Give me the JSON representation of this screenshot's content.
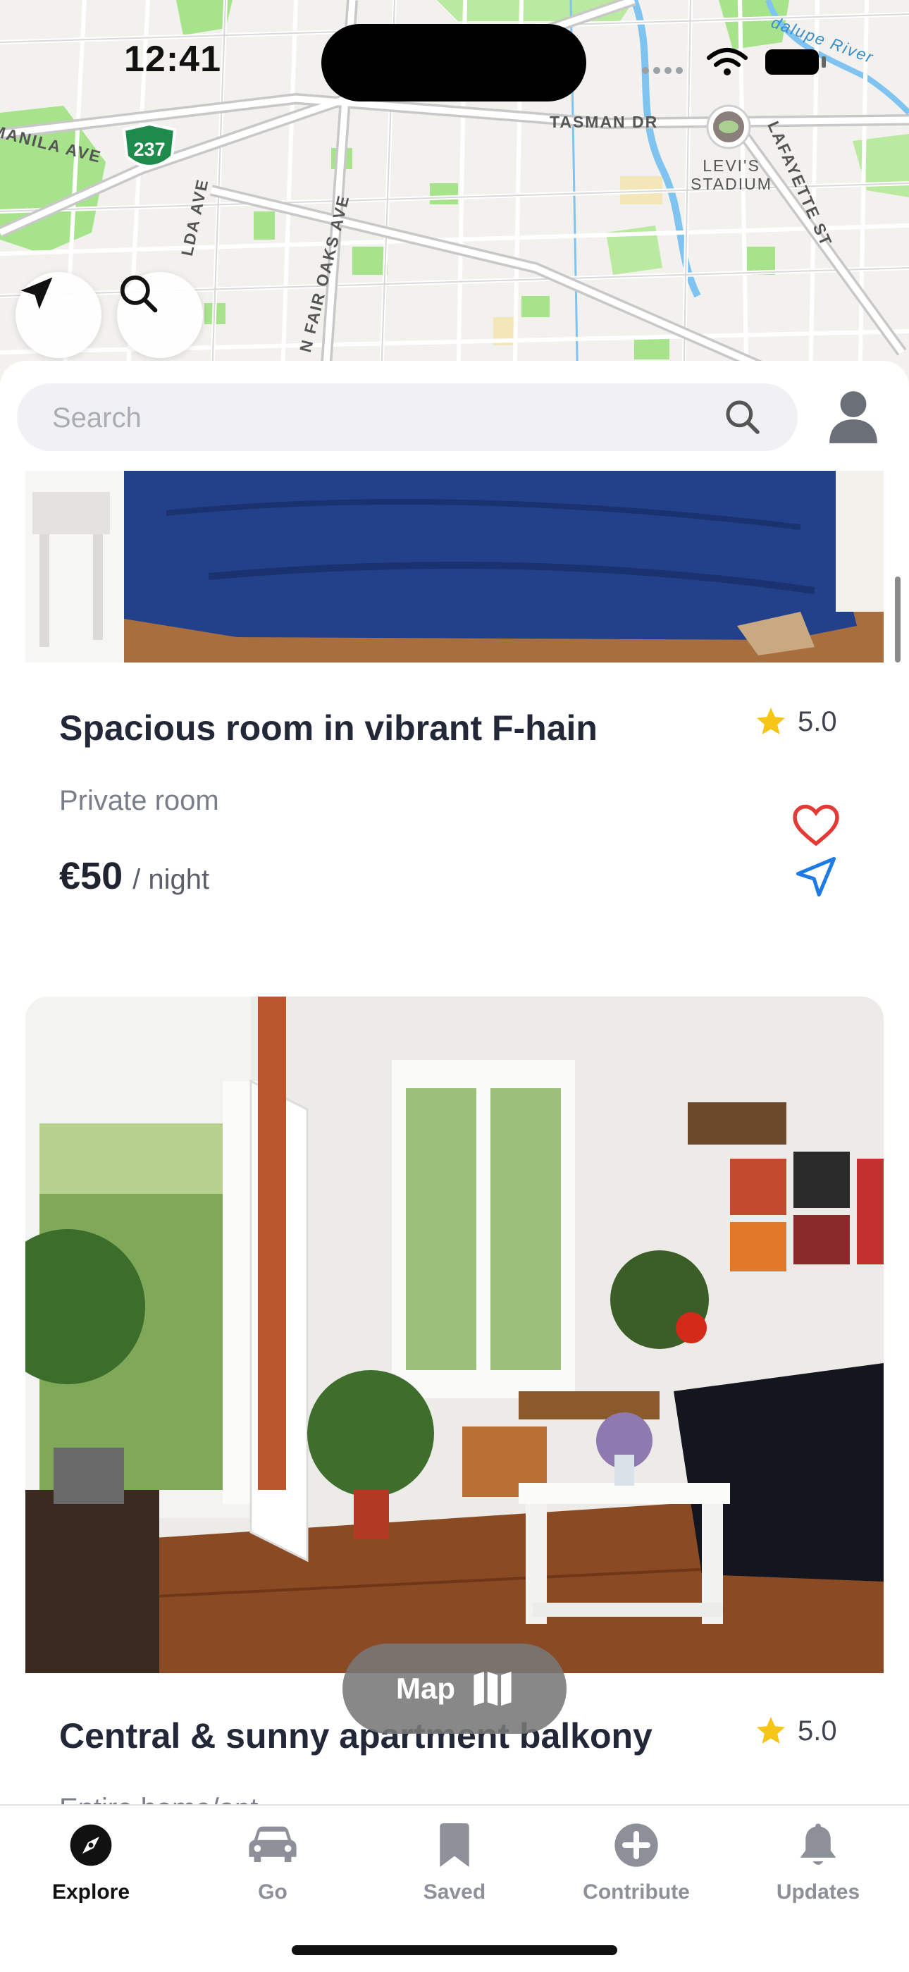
{
  "status_bar": {
    "time": "12:41"
  },
  "map": {
    "labels": {
      "manila_ave": "MANILA AVE",
      "tasman_dr": "TASMAN DR",
      "lafayette_st": "LAFAYETTE ST",
      "levis_stadium": "LEVI'S STADIUM",
      "lda_ave": "LDA AVE",
      "fair_oaks_ave": "N FAIR OAKS AVE",
      "guadalupe_river": "dalupe River",
      "highway": "237"
    },
    "buttons": {
      "locate_icon": "location-arrow-icon",
      "search_icon": "search-icon"
    }
  },
  "search": {
    "placeholder": "Search",
    "value": ""
  },
  "listings": [
    {
      "title": "Spacious room in vibrant F-hain",
      "rating": "5.0",
      "type": "Private room",
      "price": "€50",
      "price_unit": "/ night"
    },
    {
      "title": "Central & sunny apartment balkony",
      "rating": "5.0",
      "type": "Entire home/apt"
    }
  ],
  "map_toggle": {
    "label": "Map",
    "icon": "map-icon"
  },
  "tabs": [
    {
      "label": "Explore",
      "icon": "compass-icon",
      "active": true
    },
    {
      "label": "Go",
      "icon": "car-icon",
      "active": false
    },
    {
      "label": "Saved",
      "icon": "bookmark-icon",
      "active": false
    },
    {
      "label": "Contribute",
      "icon": "plus-circle-icon",
      "active": false
    },
    {
      "label": "Updates",
      "icon": "bell-icon",
      "active": false
    }
  ],
  "colors": {
    "accent_heart": "#e53935",
    "accent_direction": "#1e7be6",
    "star": "#f5c518",
    "map_park": "#9ee37d",
    "map_water": "#7fc4f0"
  }
}
